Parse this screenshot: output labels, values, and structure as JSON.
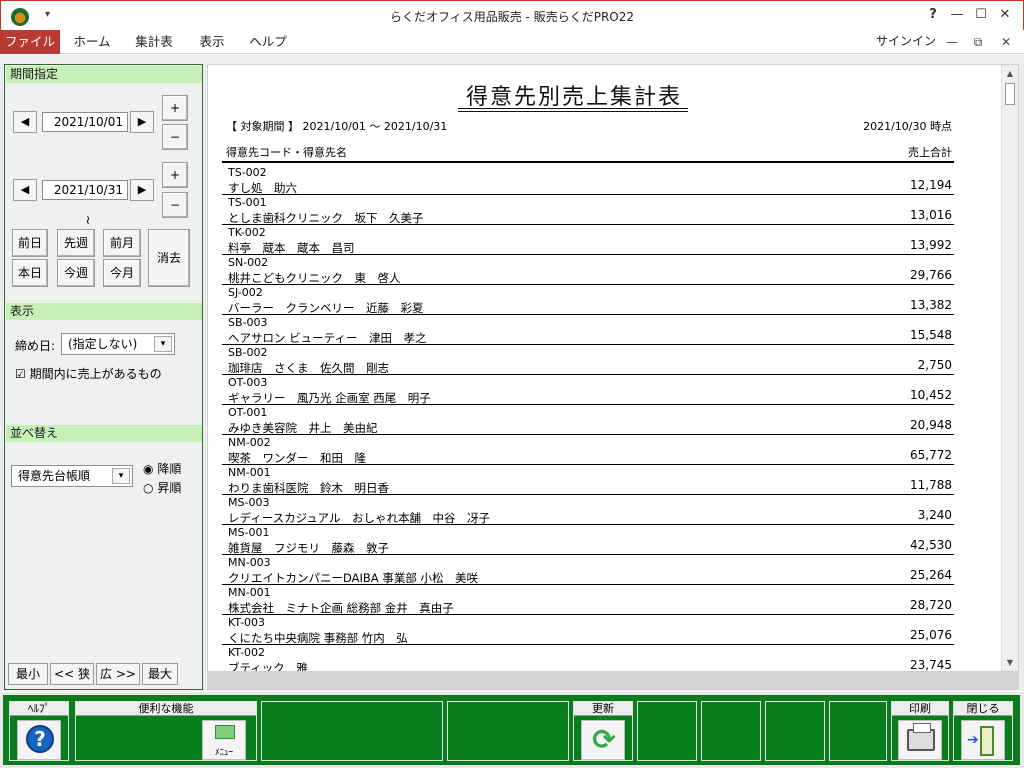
{
  "window": {
    "title": "らくだオフィス用品販売 - 販売らくだPRO22",
    "qat": "▾",
    "help_q": "?",
    "btn_minimize": "—",
    "btn_maximize": "☐",
    "btn_close": "✕"
  },
  "ribbon": {
    "tabs": [
      "ファイル",
      "ホーム",
      "集計表",
      "表示",
      "ヘルプ"
    ],
    "signin": "サインイン",
    "btn_min": "—",
    "btn_restore": "⧉",
    "btn_close": "✕"
  },
  "left": {
    "period_header": "期間指定",
    "date_from": "2021/10/01",
    "date_to": "2021/10/31",
    "tilde": "~",
    "plus": "+",
    "minus": "−",
    "prev_arrow": "◀",
    "next_arrow": "▶",
    "quick": [
      "前日",
      "先週",
      "前月",
      "本日",
      "今週",
      "今月"
    ],
    "clear": "消去",
    "display_header": "表示",
    "closing_label": "締め日:",
    "closing_value": "(指定しない)",
    "only_sales_label": "期間内に売上があるもの",
    "only_sales_checked": true,
    "sort_header": "並べ替え",
    "sort_value": "得意先台帳順",
    "sort_desc": "降順",
    "sort_asc": "昇順",
    "sort_selected": "降順",
    "nav": [
      "最小",
      "<< 狭",
      "広 >>",
      "最大"
    ]
  },
  "report": {
    "title": "得意先別売上集計表",
    "period": "【 対象期間 】 2021/10/01 ～ 2021/10/31",
    "as_of": "2021/10/30 時点",
    "col_left": "得意先コード・得意先名",
    "col_right": "売上合計",
    "rows": [
      {
        "code": "TS-002",
        "name": "すし処　助六",
        "amount": "12,194"
      },
      {
        "code": "TS-001",
        "name": "としま歯科クリニック　坂下　久美子",
        "amount": "13,016"
      },
      {
        "code": "TK-002",
        "name": "料亭　蔵本　蔵本　昌司",
        "amount": "13,992"
      },
      {
        "code": "SN-002",
        "name": "桃井こどもクリニック　東　啓人",
        "amount": "29,766"
      },
      {
        "code": "SJ-002",
        "name": "バーラー　クランベリー　近藤　彩夏",
        "amount": "13,382"
      },
      {
        "code": "SB-003",
        "name": "ヘアサロン ビューティー　津田　孝之",
        "amount": "15,548"
      },
      {
        "code": "SB-002",
        "name": "珈琲店　さくま　佐久間　剛志",
        "amount": "2,750"
      },
      {
        "code": "OT-003",
        "name": "ギャラリー　風乃光 企画室 西尾　明子",
        "amount": "10,452"
      },
      {
        "code": "OT-001",
        "name": "みゆき美容院　井上　美由紀",
        "amount": "20,948"
      },
      {
        "code": "NM-002",
        "name": "喫茶　ワンダー　和田　隆",
        "amount": "65,772"
      },
      {
        "code": "NM-001",
        "name": "わりま歯科医院　鈴木　明日香",
        "amount": "11,788"
      },
      {
        "code": "MS-003",
        "name": "レディースカジュアル　おしゃれ本舗　中谷　冴子",
        "amount": "3,240"
      },
      {
        "code": "MS-001",
        "name": "雑貨屋　フジモリ　藤森　敦子",
        "amount": "42,530"
      },
      {
        "code": "MN-003",
        "name": "クリエイトカンパニーDAIBA 事業部 小松　美咲",
        "amount": "25,264"
      },
      {
        "code": "MN-001",
        "name": "株式会社　ミナト企画 総務部 金井　真由子",
        "amount": "28,720"
      },
      {
        "code": "KT-003",
        "name": "くにたち中央病院 事務部 竹内　弘",
        "amount": "25,076"
      },
      {
        "code": "KT-002",
        "name": "ブティック　雅",
        "amount": "23,745"
      }
    ]
  },
  "scroll": {
    "up": "▲",
    "down": "▼"
  },
  "fbar": {
    "help": "ﾍﾙﾌﾟ",
    "help_glyph": "?",
    "tools": "便利な機能",
    "menu_caption": "ﾒﾆｭｰ",
    "refresh": "更新",
    "refresh_glyph": "⟳",
    "print": "印刷",
    "close": "閉じる",
    "close_glyph": "➔"
  }
}
